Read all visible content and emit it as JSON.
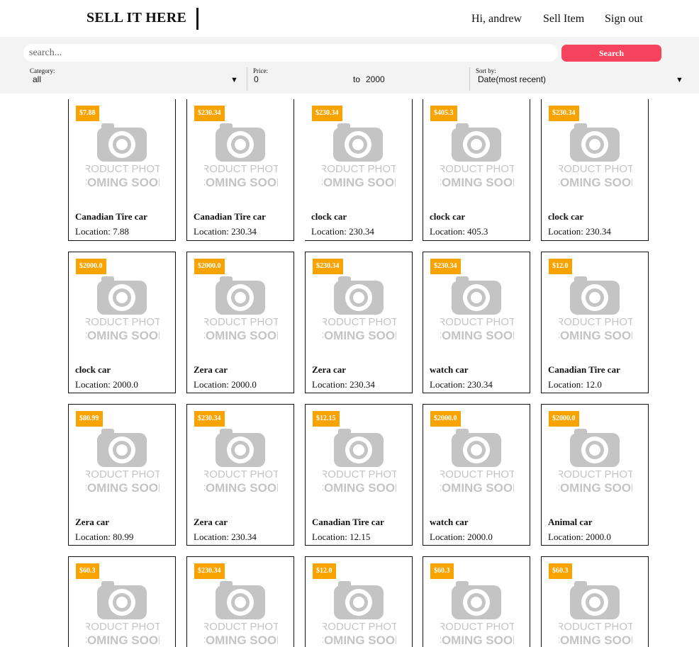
{
  "header": {
    "brand": "SELL IT HERE",
    "greeting": "Hi, andrew",
    "sell_item": "Sell Item",
    "sign_out": "Sign out"
  },
  "search": {
    "placeholder": "search...",
    "button_label": "Search",
    "button_color": "#f5425d"
  },
  "filters": {
    "category": {
      "label": "Category:",
      "value": "all"
    },
    "price": {
      "label": "Price:",
      "min": "0",
      "to": "to",
      "max": "2000"
    },
    "sort": {
      "label": "Sort by:",
      "value": "Date(most recent)"
    }
  },
  "placeholder_image": {
    "line1": "PRODUCT PHOTO",
    "line2": "COMING SOON",
    "icon": "camera-icon"
  },
  "listings": [
    {
      "price": "$7.88",
      "title": "Canadian Tire car",
      "location": "Location: 7.88"
    },
    {
      "price": "$230.34",
      "title": "Canadian Tire car",
      "location": "Location: 230.34"
    },
    {
      "price": "$230.34",
      "title": "clock car",
      "location": "Location: 230.34"
    },
    {
      "price": "$405.3",
      "title": "clock car",
      "location": "Location: 405.3"
    },
    {
      "price": "$230.34",
      "title": "clock car",
      "location": "Location: 230.34"
    },
    {
      "price": "$2000.0",
      "title": "clock car",
      "location": "Location: 2000.0"
    },
    {
      "price": "$2000.0",
      "title": "Zera car",
      "location": "Location: 2000.0"
    },
    {
      "price": "$230.34",
      "title": "Zera car",
      "location": "Location: 230.34"
    },
    {
      "price": "$230.34",
      "title": "watch car",
      "location": "Location: 230.34"
    },
    {
      "price": "$12.0",
      "title": "Canadian Tire car",
      "location": "Location: 12.0"
    },
    {
      "price": "$80.99",
      "title": "Zera car",
      "location": "Location: 80.99"
    },
    {
      "price": "$230.34",
      "title": "Zera car",
      "location": "Location: 230.34"
    },
    {
      "price": "$12.15",
      "title": "Canadian Tire car",
      "location": "Location: 12.15"
    },
    {
      "price": "$2000.0",
      "title": "watch car",
      "location": "Location: 2000.0"
    },
    {
      "price": "$2000.0",
      "title": "Animal car",
      "location": "Location: 2000.0"
    },
    {
      "price": "$60.3",
      "title": "",
      "location": ""
    },
    {
      "price": "$230.34",
      "title": "",
      "location": ""
    },
    {
      "price": "$12.0",
      "title": "",
      "location": ""
    },
    {
      "price": "$60.3",
      "title": "",
      "location": ""
    },
    {
      "price": "$60.3",
      "title": "",
      "location": ""
    }
  ],
  "colors": {
    "price_tag": "#f9a300",
    "band": "#f3f3f3"
  }
}
